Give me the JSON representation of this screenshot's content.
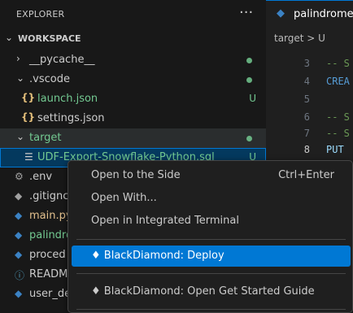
{
  "explorer": {
    "title": "EXPLORER",
    "more": "···",
    "workspace": "WORKSPACE",
    "items": [
      {
        "label": "__pycache__",
        "status": ""
      },
      {
        "label": ".vscode",
        "status": ""
      },
      {
        "label": "launch.json",
        "status": "U"
      },
      {
        "label": "settings.json",
        "status": ""
      },
      {
        "label": "target",
        "status": ""
      },
      {
        "label": "UDF-Export-Snowflake-Python.sql",
        "status": "U"
      },
      {
        "label": ".env",
        "status": ""
      },
      {
        "label": ".gitignc",
        "status": ""
      },
      {
        "label": "main.py",
        "status": ""
      },
      {
        "label": "palindro",
        "status": ""
      },
      {
        "label": "proced",
        "status": ""
      },
      {
        "label": "READM",
        "status": ""
      },
      {
        "label": "user_de",
        "status": ""
      }
    ]
  },
  "editor": {
    "tab_label": "palindrome",
    "breadcrumb": "target > U",
    "lines": [
      {
        "num": "3",
        "text": "-- S"
      },
      {
        "num": "4",
        "text": "CREA"
      },
      {
        "num": "5",
        "text": ""
      },
      {
        "num": "6",
        "text": "-- S"
      },
      {
        "num": "7",
        "text": "-- S"
      },
      {
        "num": "8",
        "text": "PUT"
      }
    ]
  },
  "context_menu": {
    "items": [
      {
        "label": "Open to the Side",
        "shortcut": "Ctrl+Enter"
      },
      {
        "label": "Open With..."
      },
      {
        "label": "Open in Integrated Terminal"
      },
      {
        "label": "♦ BlackDiamond: Deploy"
      },
      {
        "label": "♦ BlackDiamond: Open Get Started Guide"
      }
    ]
  },
  "colors": {
    "accent": "#0078d4",
    "git_untracked": "#73c991",
    "json_icon": "#e5c07b",
    "python_icon": "#3b82c4"
  }
}
